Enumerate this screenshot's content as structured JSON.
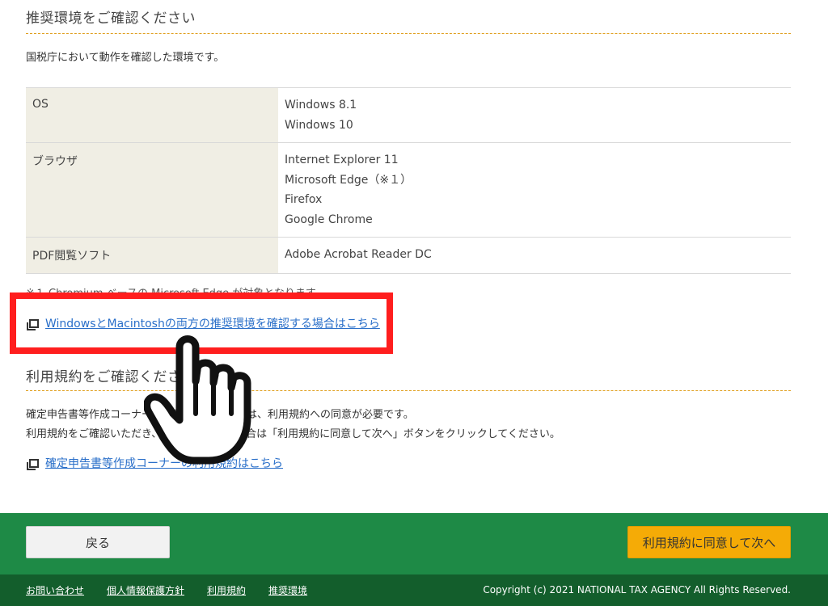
{
  "env_section": {
    "heading": "推奨環境をご確認ください",
    "lead": "国税庁において動作を確認した環境です。",
    "rows": [
      {
        "label": "OS",
        "values": [
          "Windows 8.1",
          "Windows 10"
        ]
      },
      {
        "label": "ブラウザ",
        "values": [
          "Internet Explorer 11",
          "Microsoft Edge（※１）",
          "Firefox",
          "Google Chrome"
        ]
      },
      {
        "label": "PDF閲覧ソフト",
        "values": [
          "Adobe Acrobat Reader DC"
        ]
      }
    ],
    "note": "※１ Chromium ベースの Microsoft Edge が対象となります。",
    "link_label": "WindowsとMacintoshの両方の推奨環境を確認する場合はこちら"
  },
  "terms_section": {
    "heading": "利用規約をご確認ください",
    "text_line1": "確定申告書等作成コーナーをご利用いただくには、利用規約への同意が必要です。",
    "text_line2": "利用規約をご確認いただき、同意いただける場合は「利用規約に同意して次へ」ボタンをクリックしてください。",
    "link_label": "確定申告書等作成コーナーの利用規約はこちら"
  },
  "actions": {
    "back_label": "戻る",
    "agree_label": "利用規約に同意して次へ"
  },
  "footer": {
    "links": [
      "お問い合わせ",
      "個人情報保護方針",
      "利用規約",
      "推奨環境"
    ],
    "copyright": "Copyright (c) 2021 NATIONAL TAX AGENCY All Rights Reserved."
  },
  "colors": {
    "action_bar": "#1e8a46",
    "footer": "#135e2c",
    "agree_button": "#f5ab06",
    "highlight": "#ff1e1e",
    "link": "#2a6fc9"
  }
}
